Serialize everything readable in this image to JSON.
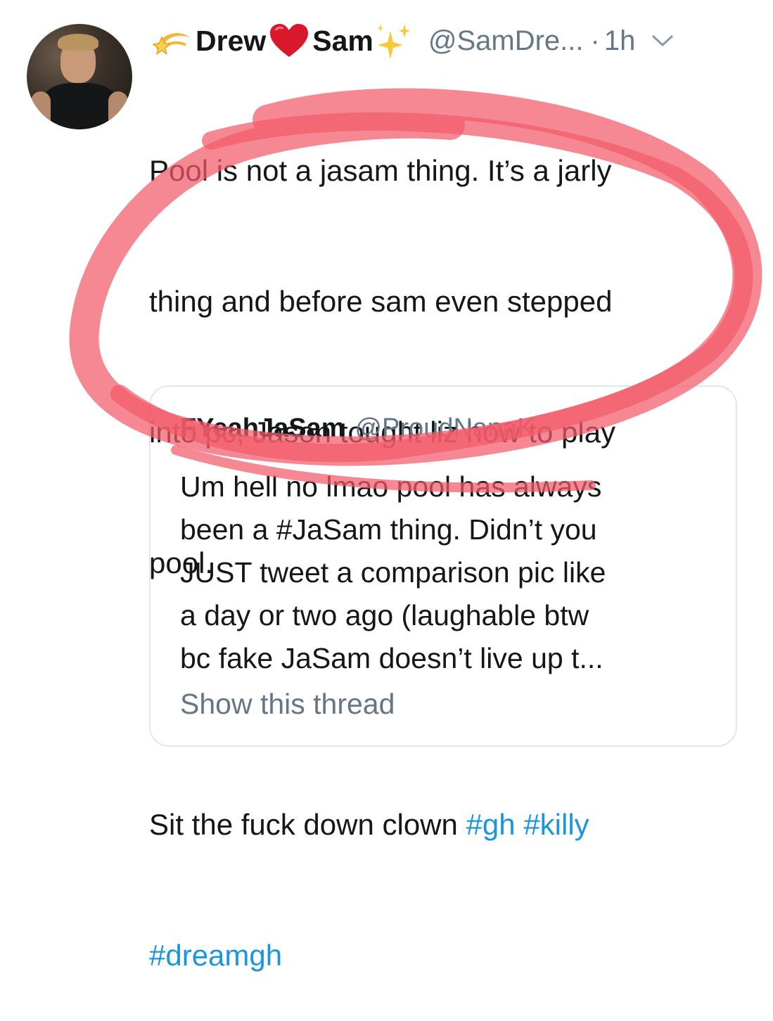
{
  "tweet": {
    "author_name": "Drew",
    "author_name_2": "Sam",
    "handle": "@SamDre...",
    "separator": "·",
    "time": "1h",
    "text_lines": [
      "Pool is not a jasam thing. It’s a jarly",
      "thing and before sam even stepped",
      "into pc, Jason tought liz how to play",
      "pool.",
      "",
      "Sit the fuck down clown "
    ],
    "hashtags_line1": [
      "#gh",
      "#killy"
    ],
    "hashtags_line2": [
      "#dreamgh"
    ]
  },
  "quoted_tweet": {
    "author_name": "FYeahJaSam",
    "handle": "@ProudNanaK",
    "text_lines": [
      "Um hell no lmao pool has always",
      "been a #JaSam thing. Didn’t you",
      "JUST tweet a comparison pic like",
      "a day or two ago (laughable btw",
      "bc fake JaSam doesn’t live up t..."
    ],
    "show_thread": "Show this thread"
  },
  "icons": {
    "name_prefix": "dizzy-emoji",
    "name_middle": "red-heart-emoji",
    "name_suffix": "sparkles-emoji",
    "menu": "chevron-down-icon"
  },
  "colors": {
    "hashtag": "#1b95e0",
    "secondary_text": "#657786",
    "annotation": "#f25a6a"
  }
}
